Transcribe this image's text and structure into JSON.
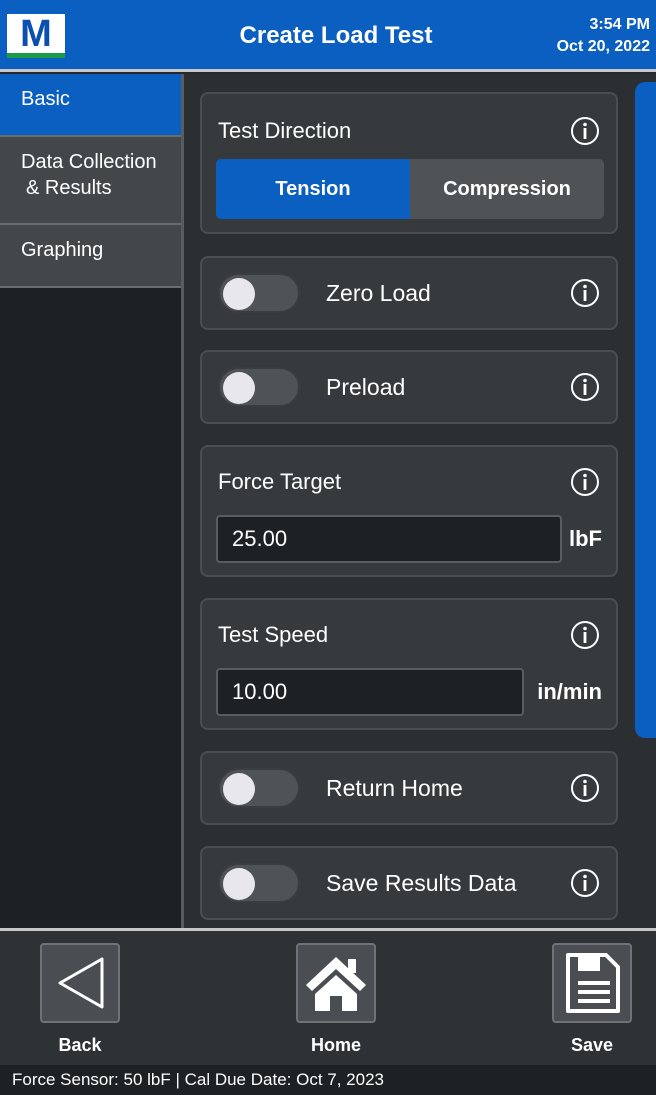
{
  "header": {
    "logo_letter": "M",
    "title": "Create Load Test",
    "time": "3:54 PM",
    "date": "Oct 20, 2022"
  },
  "sidebar": {
    "items": [
      {
        "label": "Basic",
        "active": true
      },
      {
        "label_line1": "Data Collection",
        "label_line2": "& Results",
        "active": false
      },
      {
        "label": "Graphing",
        "active": false
      }
    ]
  },
  "main": {
    "test_direction": {
      "label": "Test Direction",
      "options": [
        "Tension",
        "Compression"
      ],
      "selected": "Tension"
    },
    "zero_load": {
      "label": "Zero Load",
      "enabled": false
    },
    "preload": {
      "label": "Preload",
      "enabled": false
    },
    "force_target": {
      "label": "Force Target",
      "value": "25.00",
      "unit": "lbF"
    },
    "test_speed": {
      "label": "Test Speed",
      "value": "10.00",
      "unit": "in/min"
    },
    "return_home": {
      "label": "Return Home",
      "enabled": false
    },
    "save_results": {
      "label": "Save Results Data",
      "enabled": false
    }
  },
  "bottom": {
    "back_label": "Back",
    "home_label": "Home",
    "save_label": "Save"
  },
  "status": {
    "text": "Force Sensor: 50 lbF  |  Cal Due Date: Oct 7, 2023"
  },
  "colors": {
    "accent": "#0b5fc0",
    "background": "#26292c",
    "card": "#373a3d"
  },
  "icons": [
    "info-icon",
    "back-arrow-icon",
    "home-icon",
    "save-icon"
  ]
}
